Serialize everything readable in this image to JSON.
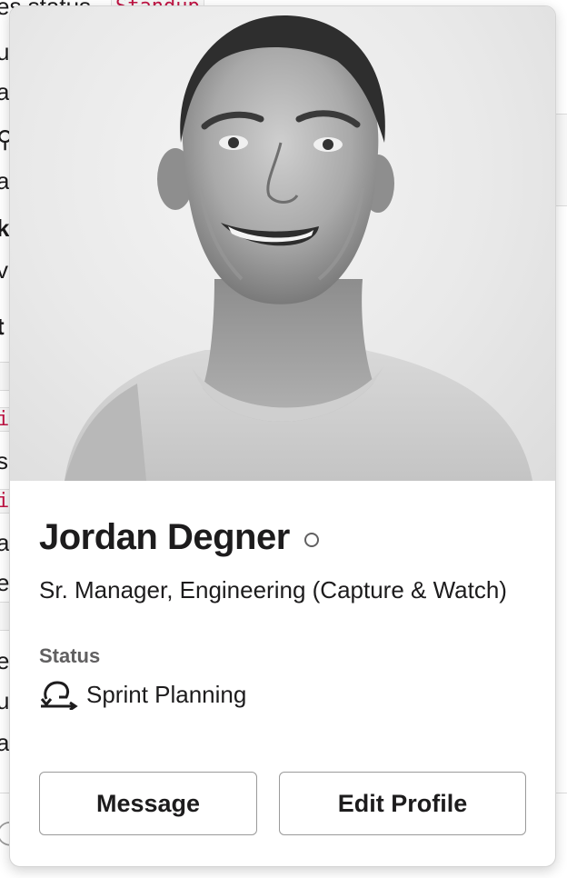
{
  "background": {
    "fragments": [
      "es status",
      "u",
      "a",
      "a",
      "vl",
      "s",
      "a",
      "e",
      "e",
      "u",
      "a"
    ],
    "bold_fragments": [
      "k",
      "t"
    ],
    "code_fragments": [
      "Standup",
      "i",
      "i"
    ]
  },
  "profile": {
    "name": "Jordan Degner",
    "title": "Sr. Manager, Engineering (Capture & Watch)",
    "presence": "away",
    "status_label": "Status",
    "status_text": "Sprint Planning",
    "status_emoji": "sprint-loop-icon"
  },
  "actions": {
    "message_label": "Message",
    "edit_label": "Edit Profile"
  },
  "colors": {
    "text": "#1d1c1d",
    "muted": "#616061",
    "border": "#9a9a9a",
    "code": "#c01343"
  }
}
